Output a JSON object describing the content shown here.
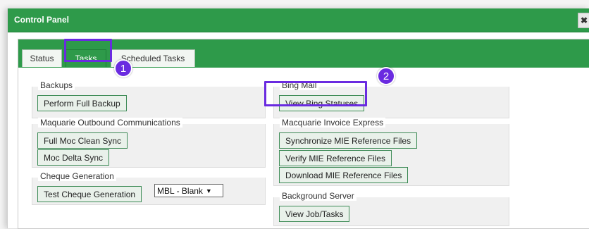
{
  "window": {
    "title": "Control Panel",
    "close_symbol": "✖"
  },
  "tabs": [
    {
      "label": "Status"
    },
    {
      "label": "Tasks"
    },
    {
      "label": "Scheduled Tasks"
    }
  ],
  "sections": {
    "backups": {
      "legend": "Backups",
      "buttons": [
        "Perform Full Backup"
      ]
    },
    "outbound": {
      "legend": "Maquarie Outbound Communications",
      "buttons": [
        "Full Moc Clean Sync",
        "Moc Delta Sync"
      ]
    },
    "cheque": {
      "legend": "Cheque Generation",
      "buttons": [
        "Test Cheque Generation"
      ],
      "select_value": "MBL - Blank",
      "select_arrow": "▼"
    },
    "bing": {
      "legend": "Bing Mail",
      "buttons": [
        "View Bing Statuses"
      ]
    },
    "invoice": {
      "legend": "Macquarie Invoice Express",
      "buttons": [
        "Synchronize MIE Reference Files",
        "Verify MIE Reference Files",
        "Download MIE Reference Files"
      ]
    },
    "background": {
      "legend": "Background Server",
      "buttons": [
        "View Job/Tasks"
      ]
    }
  },
  "annotations": {
    "marker_1": "1",
    "marker_2": "2"
  },
  "colors": {
    "accent_green": "#2e9a4a",
    "highlight_purple": "#6a2be0"
  }
}
